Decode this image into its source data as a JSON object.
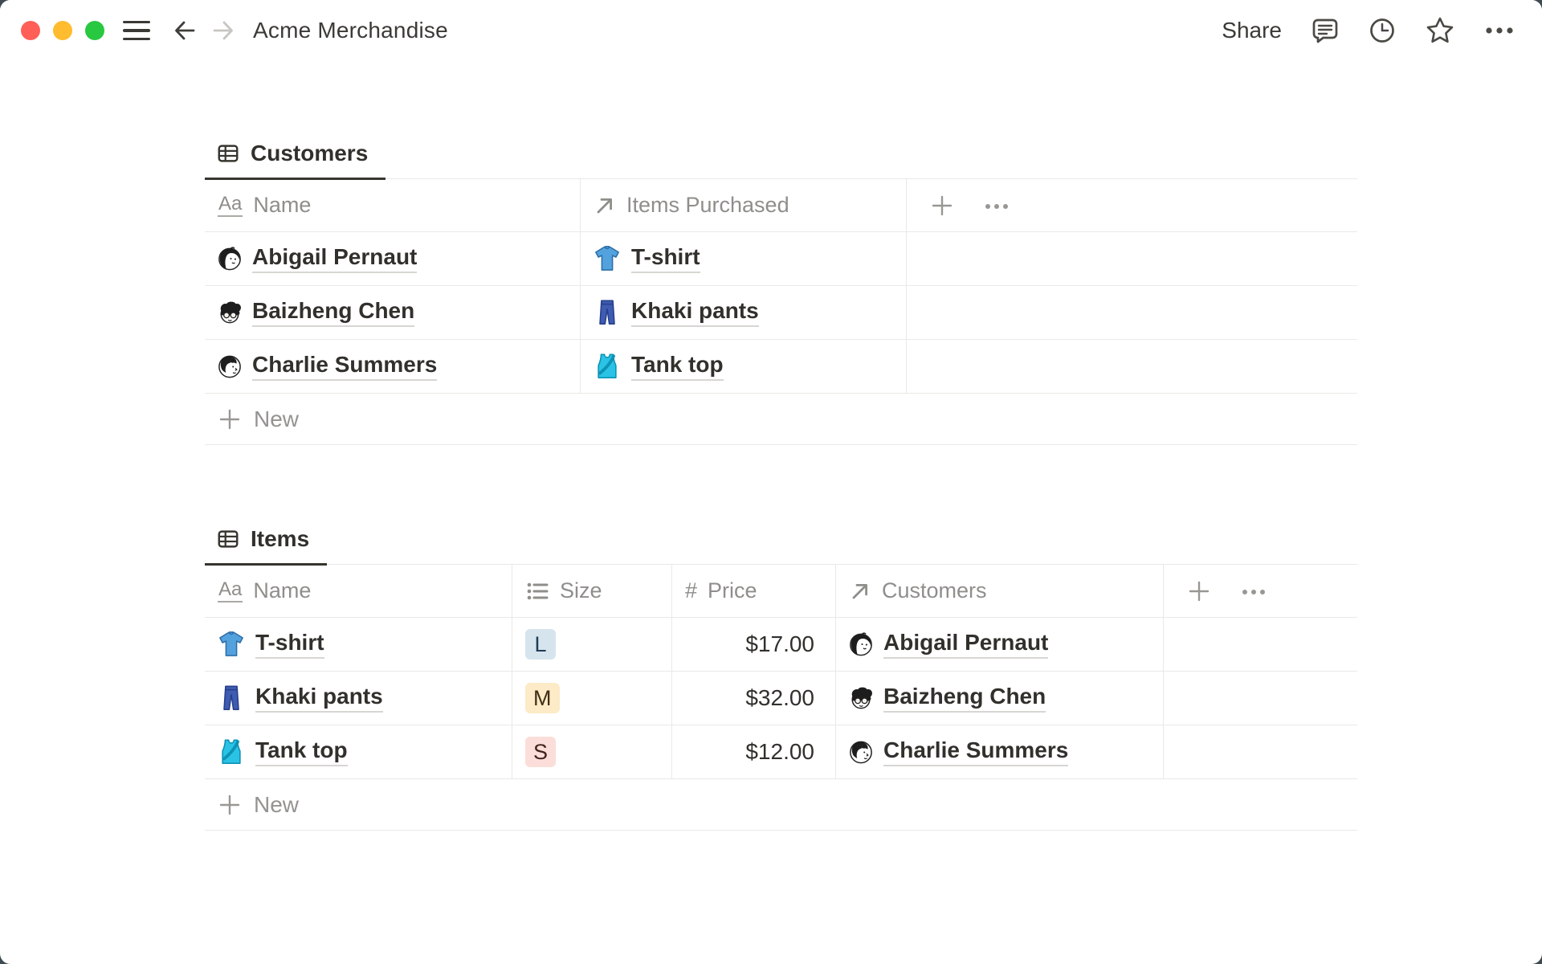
{
  "colors": {
    "traffic_red": "#ff5f57",
    "traffic_yellow": "#febc2e",
    "traffic_green": "#28c840",
    "text_primary": "#32302c",
    "text_secondary": "#8f8e8a",
    "divider": "#e9e9e7",
    "badge_blue_bg": "#d6e4ee",
    "badge_yellow_bg": "#fcebc6",
    "badge_red_bg": "#fbded9"
  },
  "topbar": {
    "title": "Acme Merchandise",
    "share_label": "Share",
    "icons": [
      "hamburger-icon",
      "back-arrow-icon",
      "forward-arrow-icon",
      "comment-icon",
      "clock-icon",
      "star-icon",
      "ellipsis-icon"
    ]
  },
  "customers": {
    "tab": "Customers",
    "columns": {
      "name": "Name",
      "items_purchased": "Items Purchased"
    },
    "rows": [
      {
        "name": "Abigail Pernaut",
        "item": "T-shirt"
      },
      {
        "name": "Baizheng Chen",
        "item": "Khaki pants"
      },
      {
        "name": "Charlie Summers",
        "item": "Tank top"
      }
    ],
    "new_label": "New"
  },
  "items": {
    "tab": "Items",
    "columns": {
      "name": "Name",
      "size": "Size",
      "price": "Price",
      "customers": "Customers"
    },
    "rows": [
      {
        "name": "T-shirt",
        "size": "L",
        "size_color": "blue",
        "price": "$17.00",
        "customer": "Abigail Pernaut"
      },
      {
        "name": "Khaki pants",
        "size": "M",
        "size_color": "yellow",
        "price": "$32.00",
        "customer": "Baizheng Chen"
      },
      {
        "name": "Tank top",
        "size": "S",
        "size_color": "red",
        "price": "$12.00",
        "customer": "Charlie Summers"
      }
    ],
    "new_label": "New"
  }
}
